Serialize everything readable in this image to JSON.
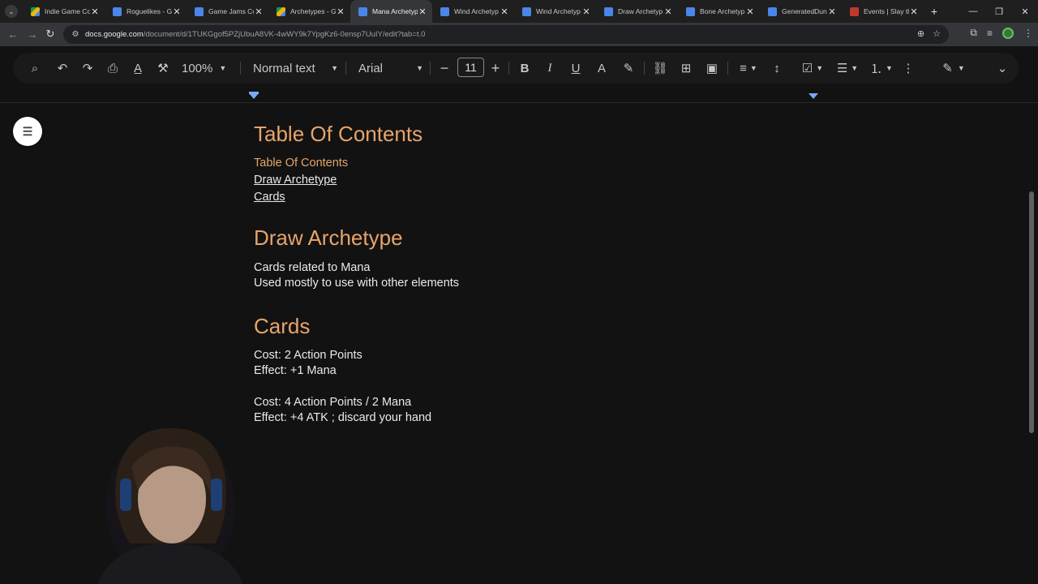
{
  "tabs": [
    {
      "title": "Indie Game Co",
      "icon": "drive-icon",
      "active": false
    },
    {
      "title": "Roguelikes - G",
      "icon": "doc-icon",
      "active": false
    },
    {
      "title": "Game Jams Co",
      "icon": "doc-icon",
      "active": false
    },
    {
      "title": "Archetypes - G",
      "icon": "drive-icon",
      "active": false
    },
    {
      "title": "Mana Archetyp",
      "icon": "doc-icon",
      "active": true
    },
    {
      "title": "Wind Archetyp",
      "icon": "doc-icon",
      "active": false
    },
    {
      "title": "Wind Archetyp",
      "icon": "doc-icon",
      "active": false
    },
    {
      "title": "Draw Archetyp",
      "icon": "doc-icon",
      "active": false
    },
    {
      "title": "Bone Archetyp",
      "icon": "doc-icon",
      "active": false
    },
    {
      "title": "GeneratedDun",
      "icon": "doc-icon",
      "active": false
    },
    {
      "title": "Events | Slay th",
      "icon": "red-icon",
      "active": false
    }
  ],
  "address": {
    "url_host": "docs.google.com",
    "url_path": "/document/d/1TUKGgof5PZjUbuA8VK-4wWY9k7YpgKz6-0ensp7UuIY/edit?tab=t.0"
  },
  "toolbar": {
    "zoom": "100%",
    "style": "Normal text",
    "font": "Arial",
    "font_size": "11"
  },
  "document": {
    "toc_heading": "Table Of Contents",
    "toc_entries": [
      "Table Of Contents",
      "Draw Archetype",
      "Cards"
    ],
    "section1_heading": "Draw Archetype",
    "section1_lines": [
      "Cards related to Mana",
      "Used mostly to use with other elements"
    ],
    "section2_heading": "Cards",
    "card1": {
      "cost": "Cost: 2 Action Points",
      "effect": "Effect: +1 Mana"
    },
    "card2": {
      "cost": "Cost: 4 Action Points / 2 Mana",
      "effect": "Effect: +4 ATK ; discard your hand"
    }
  },
  "colors": {
    "heading": "#e8a46a",
    "background": "#121212",
    "text": "#eaeaea"
  }
}
